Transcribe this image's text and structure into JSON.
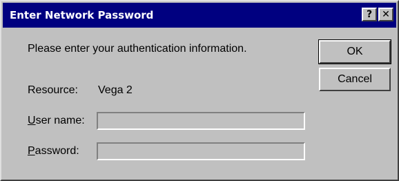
{
  "window": {
    "title": "Enter Network Password",
    "help_glyph": "?",
    "close_glyph": "✕"
  },
  "prompt": "Please enter your authentication information.",
  "resource": {
    "label": "Resource:",
    "value": "Vega 2"
  },
  "username": {
    "label_accel": "U",
    "label_rest": "ser name:",
    "value": ""
  },
  "password": {
    "label_accel": "P",
    "label_rest": "assword:",
    "value": ""
  },
  "buttons": {
    "ok": "OK",
    "cancel": "Cancel"
  },
  "colors": {
    "titlebar": "#000080",
    "face": "#c0c0c0"
  }
}
